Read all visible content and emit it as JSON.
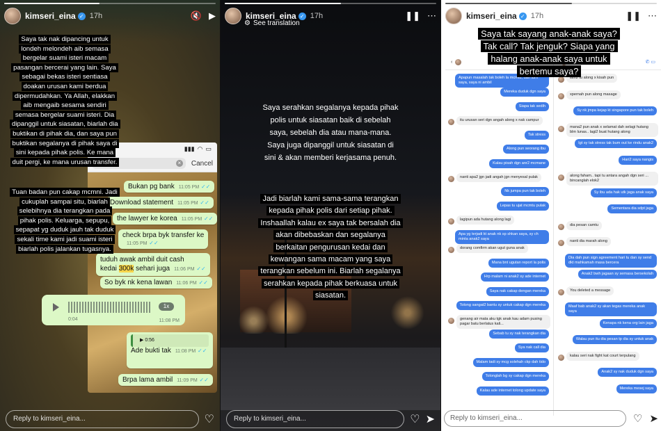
{
  "story": {
    "username": "kimseri_eina",
    "time": "17h",
    "reply_placeholder": "Reply to kimseri_eina..."
  },
  "panel1": {
    "progress": 0.45,
    "caption1": "Saya tak nak dipancing untuk londeh melondeh aib semasa bergelar suami isteri macam pasangan bercerai yang lain. Saya sebagai bekas isteri sentiasa doakan urusan kami berdua dipermudahkan. Ya Allah, elakkan aib mengaib sesama sendiri semasa bergelar suami isteri. Dia dipanggil untuk siasatan, biarlah dia buktikan di pihak dia, dan saya pun buktikan segalanya di pihak saya di sini kepada pihak polis. Ke mana duit pergi, ke mana urusan transfer.",
    "caption2": "Tuan badan pun cakap mcmni. Jadi cukuplah sampai situ, biarlah selebihnya dia terangkan pada pihak polis. Keluarga, sepupu, sepapat yg duduk jauh tak duduk sekali time kami jadi suami isteri biarlah polis jalankan tugasnya.",
    "phone": {
      "cancel": "Cancel",
      "messages": [
        {
          "text": "Bukan pg bank",
          "time": "11:05 PM"
        },
        {
          "text": "Download statement",
          "time": "11:05 PM"
        },
        {
          "text": "the lawyer ke korea",
          "time": "11:05 PM"
        },
        {
          "text": "check brpa byk transfer ke",
          "time": "11:05 PM"
        },
        {
          "text": "tuduh awak ambil duit cash",
          "time": ""
        },
        {
          "text_pre": "kedai ",
          "text_hl": "300k",
          "text_post": " sehari juga",
          "time": "11:06 PM"
        },
        {
          "text": "So byk nk kena lawan",
          "time": "11:06 PM"
        },
        {
          "text": "Ade bukti tak",
          "time": "11:08 PM"
        },
        {
          "text": "Brpa lama ambil",
          "time": "11:09 PM"
        }
      ],
      "voice": {
        "duration": "0:04",
        "speed": "1x",
        "time": "11:08 PM"
      },
      "quoted_time": "0:56"
    }
  },
  "panel2": {
    "progress": 0.55,
    "see_translation": "See translation",
    "caption1": "Saya serahkan segalanya kepada pihak polis untuk siasatan baik di sebelah saya, sebelah dia atau mana-mana. Saya juga dipanggil untuk siasatan di sini & akan memberi kerjasama penuh.",
    "caption2": "Jadi biarlah kami sama-sama terangkan kepada pihak polis dari setiap pihak. Inshaallah kalau ex saya tak bersalah dia akan dibebaskan dan segalanya berkaitan pengurusan kedai dan kewangan sama macam yang saya terangkan sebelum ini. Biarlah segalanya serahkan kepada pihak berkuasa untuk siasatan."
  },
  "panel3": {
    "progress": 0.6,
    "question": "Saya tak sayang anak-anak saya? Tak call? Tak jenguk? Siapa yang halang anak-anak saya untuk bertemu saya?",
    "left_chat": [
      {
        "dir": "out",
        "text": "Apapun masalah tak boleh la mcmtu, dan turn saya, saya ni ambil"
      },
      {
        "dir": "out",
        "text": "Mereka duduk dgn saya"
      },
      {
        "dir": "out",
        "text": "Siapa tak sedih"
      },
      {
        "dir": "in",
        "text": "itu urusan seri dgn angah along x nak campur"
      },
      {
        "dir": "out",
        "text": "Tak stress"
      },
      {
        "dir": "out",
        "text": "Along pun seorang ibu"
      },
      {
        "dir": "out",
        "text": "Kalau pisah dgn anr2 mcmane"
      },
      {
        "dir": "in",
        "text": "nanti apa2 jgn jadi angah jgn menyesal pulak"
      },
      {
        "dir": "out",
        "text": "Nk jumpa pun tak boleh"
      },
      {
        "dir": "out",
        "text": "Lepas tu ujat mcmtu pulak"
      },
      {
        "dir": "in",
        "text": "lagipun ada hutang along lagi"
      },
      {
        "dir": "out",
        "text": "Apa yg terjadi kt anak nk sp shkan saya, sy ch minta anak2 saya"
      },
      {
        "dir": "in",
        "text": "dorang comfirm akan ugut guna anak"
      },
      {
        "dir": "out",
        "text": "Mana bnt ugutan report la polis"
      },
      {
        "dir": "out",
        "text": "Hrp malam ni anak2 sy ade internet"
      },
      {
        "dir": "out",
        "text": "Saya nak cakap dengan mereka"
      },
      {
        "dir": "out",
        "text": "Tolong sangat2 bantu sy untuk cakap dgn mereka"
      },
      {
        "dir": "in",
        "text": "genang air mata aku tgk anak kau adam pusing pagar batu berlatus kali..."
      },
      {
        "dir": "out",
        "text": "Sebab tu sy nak terangkan dia"
      },
      {
        "dir": "out",
        "text": "Sya nak call dia"
      },
      {
        "dir": "out",
        "text": "Malam tadi sy mcg solehah ckp dah tido"
      },
      {
        "dir": "out",
        "text": "Tolonglah bg sy cakap dgn mereka"
      },
      {
        "dir": "out",
        "text": "Kalau ade internet tolong update saya"
      }
    ],
    "right_chat": [
      {
        "dir": "in",
        "text": "lain2 tu along x kisah pun"
      },
      {
        "dir": "in",
        "text": "xpernah pun along masage"
      },
      {
        "dir": "out",
        "text": "Sy nk jmpa kejap kt singapore pun tak boleh"
      },
      {
        "dir": "in",
        "text": "mana2 pun anak x selamat dah selagi hutang blm lunas.. lagi2 buat hutang along"
      },
      {
        "dir": "out",
        "text": "Igt sy tak stress tak bum out ke rindu anak2"
      },
      {
        "dir": "out",
        "text": "Hari2 saya nangis"
      },
      {
        "dir": "in",
        "text": "along faham.. tapi tu antara angah dgn seri ... bincanglah elok2"
      },
      {
        "dir": "out",
        "text": "Sy ibu ada hak utk jaga anak saya"
      },
      {
        "dir": "out",
        "text": "Sementara dia sdpt jaga"
      },
      {
        "dir": "in",
        "text": "dia pesan camtu"
      },
      {
        "dir": "in",
        "text": "nanti dia marah along"
      },
      {
        "dir": "out",
        "text": "Dia dah pun sign agreement hari tu dan sy send dkt mahkamah masa bercera"
      },
      {
        "dir": "out",
        "text": "Anak2 bwh jagaan sy semasa bersekolah"
      },
      {
        "dir": "in",
        "text": "You deleted a message"
      },
      {
        "dir": "out",
        "text": "Maaf bab anak2 sy akan tegas mereka anak saya"
      },
      {
        "dir": "out",
        "text": "Kenapa nk kena org lain jaga"
      },
      {
        "dir": "out",
        "text": "Walau pun itu dia pesan tp dia sy untuk anak"
      },
      {
        "dir": "in",
        "text": "kalau seri nak fight kat court terpulang"
      },
      {
        "dir": "out",
        "text": "Anak2 sy nak duduk dgn saya"
      },
      {
        "dir": "out",
        "text": "Mereka mesej saya"
      }
    ]
  }
}
